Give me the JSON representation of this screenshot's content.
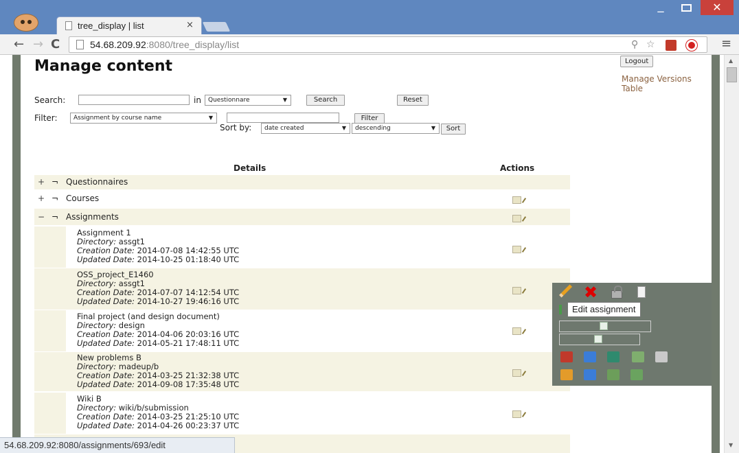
{
  "browser": {
    "tab_title": "tree_display | list",
    "tab_close": "×",
    "url_host": "54.68.209.92",
    "url_rest": ":8080/tree_display/list",
    "status_url": "54.68.209.92:8080/assignments/693/edit"
  },
  "page": {
    "title": "Manage content",
    "logout_label": "Logout",
    "manage_versions_label": "Manage Versions Table"
  },
  "search": {
    "label": "Search:",
    "value": "",
    "in_label": "in",
    "in_selected": "Questionnare",
    "search_button": "Search",
    "reset_button": "Reset"
  },
  "filter": {
    "label": "Filter:",
    "selected": "Assignment by course name",
    "value": "",
    "filter_button": "Filter"
  },
  "sort": {
    "label": "Sort by:",
    "field": "date created",
    "order": "descending",
    "sort_button": "Sort"
  },
  "table": {
    "details_header": "Details",
    "actions_header": "Actions",
    "folders": [
      {
        "toggle": "+",
        "glyph": "¬",
        "name": "Questionnaires"
      },
      {
        "toggle": "+",
        "glyph": "¬",
        "name": "Courses"
      },
      {
        "toggle": "−",
        "glyph": "¬",
        "name": "Assignments"
      }
    ],
    "labels": {
      "directory": "Directory:",
      "creation": "Creation Date:",
      "updated": "Updated Date:"
    },
    "assignments": [
      {
        "name": "Assignment 1",
        "directory": "assgt1",
        "created": "2014-07-08 14:42:55 UTC",
        "updated": "2014-10-25 01:18:40 UTC"
      },
      {
        "name": "OSS_project_E1460",
        "directory": "assgt1",
        "created": "2014-07-07 14:12:54 UTC",
        "updated": "2014-10-27 19:46:16 UTC"
      },
      {
        "name": "Final project (and design document)",
        "directory": "design",
        "created": "2014-04-06 20:03:16 UTC",
        "updated": "2014-05-21 17:48:11 UTC"
      },
      {
        "name": "New problems B",
        "directory": "madeup/b",
        "created": "2014-03-25 21:32:38 UTC",
        "updated": "2014-09-08 17:35:48 UTC"
      },
      {
        "name": "Wiki B",
        "directory": "wiki/b/submission",
        "created": "2014-03-25 21:25:10 UTC",
        "updated": "2014-04-26 00:23:37 UTC"
      }
    ]
  },
  "popup": {
    "tooltip": "Edit assignment",
    "icons": [
      "pencil-icon",
      "delete-icon",
      "lock-icon",
      "copy-icon"
    ],
    "row1_colors": [
      "#c0392b",
      "#3b7dd8",
      "#2f8a6e",
      "#7fae6e",
      "#c9c9c9"
    ],
    "row2_colors": [
      "#e39b2a",
      "#3b7dd8",
      "#6c9e5a",
      "#6aa35f"
    ]
  }
}
